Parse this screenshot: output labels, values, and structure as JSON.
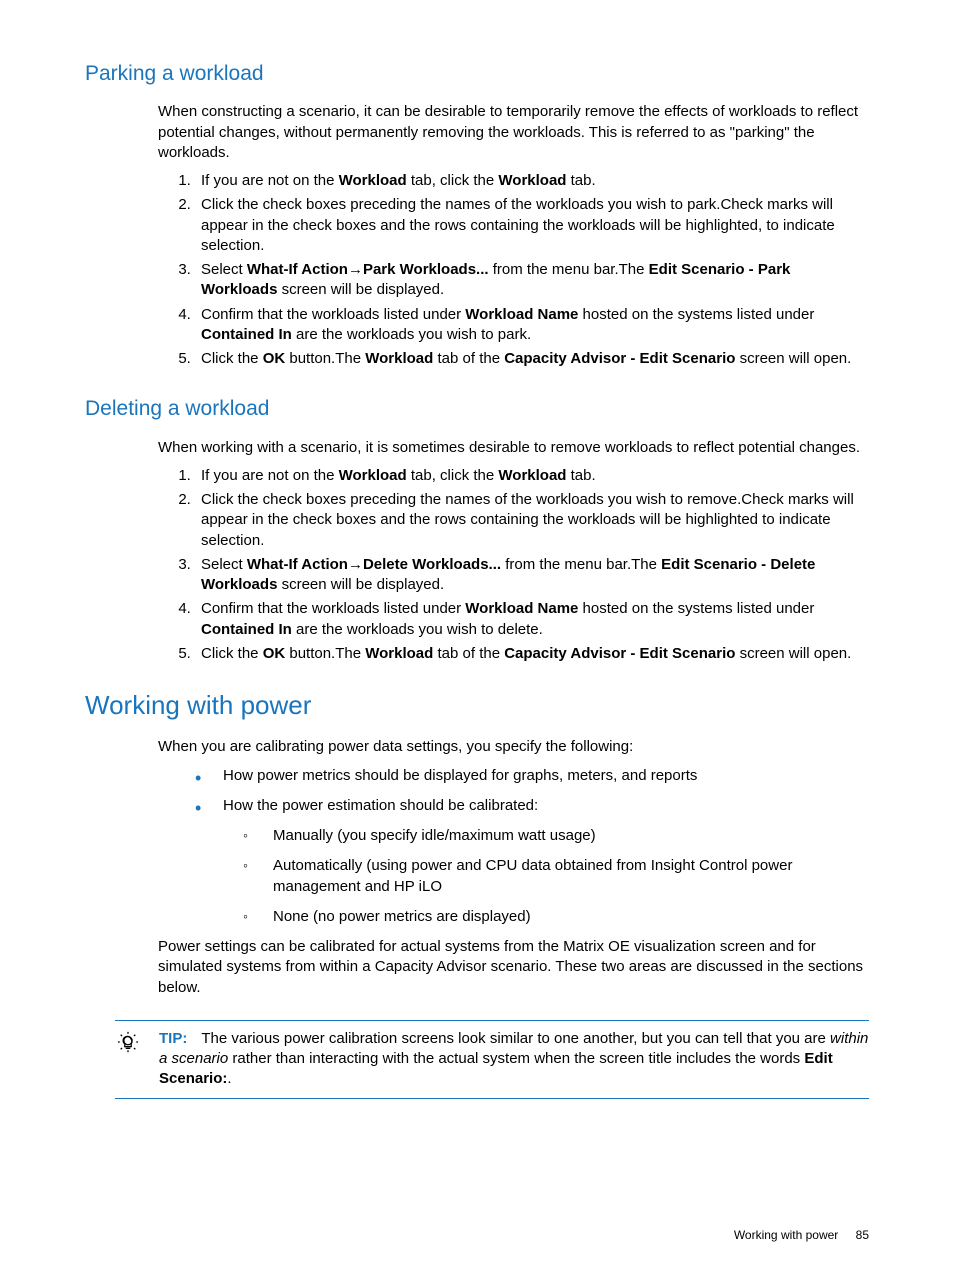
{
  "s1": {
    "title": "Parking a workload",
    "intro": "When constructing a scenario, it can be desirable to temporarily remove the effects of workloads to reflect potential changes, without permanently removing the workloads. This is referred to as \"parking\" the workloads.",
    "li1_a": "If you are not on the ",
    "li1_b": "Workload",
    "li1_c": " tab, click the ",
    "li1_d": "Workload",
    "li1_e": " tab.",
    "li2": "Click the check boxes preceding the names of the workloads you wish to park.",
    "li2_p": "Check marks will appear in the check boxes and the rows containing the workloads will be highlighted, to indicate selection.",
    "li3_a": "Select ",
    "li3_b": "What-If Action",
    "li3_arrow": "→",
    "li3_c": "Park Workloads...",
    "li3_d": " from the menu bar.",
    "li3_p_a": "The ",
    "li3_p_b": "Edit Scenario - Park Workloads",
    "li3_p_c": " screen will be displayed.",
    "li4_a": "Confirm that the workloads listed under ",
    "li4_b": "Workload Name",
    "li4_c": " hosted on the systems listed under ",
    "li4_d": "Contained In",
    "li4_e": " are the workloads you wish to park.",
    "li5_a": "Click the ",
    "li5_b": "OK",
    "li5_c": " button.",
    "li5_p_a": "The ",
    "li5_p_b": "Workload",
    "li5_p_c": " tab of the ",
    "li5_p_d": "Capacity Advisor - Edit Scenario",
    "li5_p_e": " screen will open."
  },
  "s2": {
    "title": "Deleting a workload",
    "intro": "When working with a scenario, it is sometimes desirable to remove workloads to reflect potential changes.",
    "li1_a": "If you are not on the ",
    "li1_b": "Workload",
    "li1_c": " tab, click the ",
    "li1_d": "Workload",
    "li1_e": " tab.",
    "li2": "Click the check boxes preceding the names of the workloads you wish to remove.",
    "li2_p": "Check marks will appear in the check boxes and the rows containing the workloads will be highlighted to indicate selection.",
    "li3_a": "Select ",
    "li3_b": "What-If Action",
    "li3_arrow": "→",
    "li3_c": "Delete Workloads...",
    "li3_d": " from the menu bar.",
    "li3_p_a": "The ",
    "li3_p_b": "Edit Scenario - Delete Workloads",
    "li3_p_c": " screen will be displayed.",
    "li4_a": "Confirm that the workloads listed under ",
    "li4_b": "Workload Name",
    "li4_c": " hosted on the systems listed under ",
    "li4_d": "Contained In",
    "li4_e": " are the workloads you wish to delete.",
    "li5_a": "Click the ",
    "li5_b": "OK",
    "li5_c": " button.",
    "li5_p_a": "The ",
    "li5_p_b": "Workload",
    "li5_p_c": " tab of the ",
    "li5_p_d": "Capacity Advisor - Edit Scenario",
    "li5_p_e": " screen will open."
  },
  "s3": {
    "title": "Working with power",
    "intro": "When you are calibrating power data settings, you specify the following:",
    "b1": "How power metrics should be displayed for graphs, meters, and reports",
    "b2": "How the power estimation should be calibrated:",
    "b2_s1": "Manually (you specify idle/maximum watt usage)",
    "b2_s2": "Automatically (using power and CPU data obtained from Insight Control power management and HP iLO",
    "b2_s3": "None (no power metrics are displayed)",
    "closing": "Power settings can be calibrated for actual systems from the Matrix OE visualization screen and for simulated systems from within a Capacity Advisor scenario. These two areas are discussed in the sections below."
  },
  "tip": {
    "label": "TIP:",
    "t1": "The various power calibration screens look similar to one another, but you can tell that you are ",
    "t2": "within a scenario",
    "t3": " rather than interacting with the actual system when the screen title includes the words ",
    "t4": "Edit Scenario:",
    "t5": "."
  },
  "footer": {
    "text": "Working with power",
    "page": "85"
  }
}
